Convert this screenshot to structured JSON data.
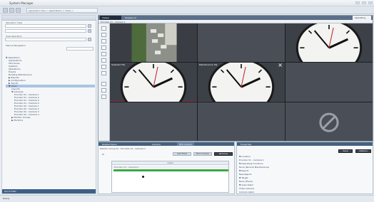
{
  "window": {
    "title": "System Manager"
  },
  "toolbar": {
    "breadcrumb": "Application Tree > Applications > Video >"
  },
  "left": {
    "operation_label": "Operation View",
    "view_operation_label": "View Operation",
    "manual_navigation_label": "Manual Navigation",
    "tree": [
      {
        "label": "▼ Operations",
        "indent": 0
      },
      {
        "label": "Applications",
        "indent": 1
      },
      {
        "label": "Structures",
        "indent": 1
      },
      {
        "label": "Systems",
        "indent": 1
      },
      {
        "label": "Operations",
        "indent": 1
      },
      {
        "label": "Events",
        "indent": 1
      },
      {
        "label": "Building Maintenance",
        "indent": 1
      },
      {
        "label": "▶ Reports",
        "indent": 1
      },
      {
        "label": "▶ Configuration",
        "indent": 1
      },
      {
        "label": "▶ Trends",
        "indent": 1
      },
      {
        "label": "▼ Video",
        "indent": 1,
        "selected": true
      },
      {
        "label": "Layouts",
        "indent": 2
      },
      {
        "label": "▼ Cameras",
        "indent": 2
      },
      {
        "label": "Encoder 01 - Camera 1",
        "indent": 3
      },
      {
        "label": "Encoder 01 - Camera 2",
        "indent": 3
      },
      {
        "label": "Encoder 01 - Camera 3",
        "indent": 3
      },
      {
        "label": "Encoder 01 - Camera 4",
        "indent": 3
      },
      {
        "label": "Encoder 02 - Camera 1",
        "indent": 3
      },
      {
        "label": "Encoder 02 - Camera 2",
        "indent": 3
      },
      {
        "label": "Encoder 02 - Camera 3",
        "indent": 3
      },
      {
        "label": "Encoder 02 - Camera 4",
        "indent": 3
      },
      {
        "label": "▶ Monitor Groups",
        "indent": 2
      },
      {
        "label": "▶ Monitors",
        "indent": 2
      }
    ],
    "footer": "Quick Filter"
  },
  "viewer": {
    "tabs": [
      "Viewer",
      "Sequencer"
    ],
    "right_tab": "Operating",
    "camera_title": "Encoder 01 - Camera 1",
    "tiles": [
      {
        "kind": "parking",
        "label": ""
      },
      {
        "kind": "empty",
        "label": ""
      },
      {
        "kind": "clock",
        "label": ""
      },
      {
        "kind": "clock",
        "label": "Selected Tile",
        "active": true
      },
      {
        "kind": "clock",
        "label": "Maintenance Tile",
        "close": true
      },
      {
        "kind": "empty",
        "label": ""
      },
      {
        "kind": "empty",
        "label": ""
      },
      {
        "kind": "empty",
        "label": ""
      },
      {
        "kind": "forbidden",
        "label": ""
      }
    ]
  },
  "bottom_left": {
    "tabs": [
      "Related Items",
      "Camera",
      "PTZ Control"
    ],
    "subtitle": "Monitor Group 01 - Encoder 01 - Camera 1",
    "field_label": "Pr",
    "buttons": [
      "Add Field",
      "Find Column",
      "Remove"
    ],
    "inner_header": "Label",
    "inner_row": "Encoder 01 - Camera 1"
  },
  "bottom_right": {
    "tab": "Properties",
    "buttons": [
      "Save",
      "Options"
    ],
    "props": [
      "▼ Location",
      "Encoder 01 - Camera 1",
      "▼ Operating Functions",
      "None (Normal Maintenance)",
      "▼ Report",
      "New Report",
      "▼ Target",
      "None (Fixed)",
      "▼ Associated",
      "Video Camera",
      "Camera Label"
    ]
  },
  "status": {
    "text": "Ready"
  }
}
